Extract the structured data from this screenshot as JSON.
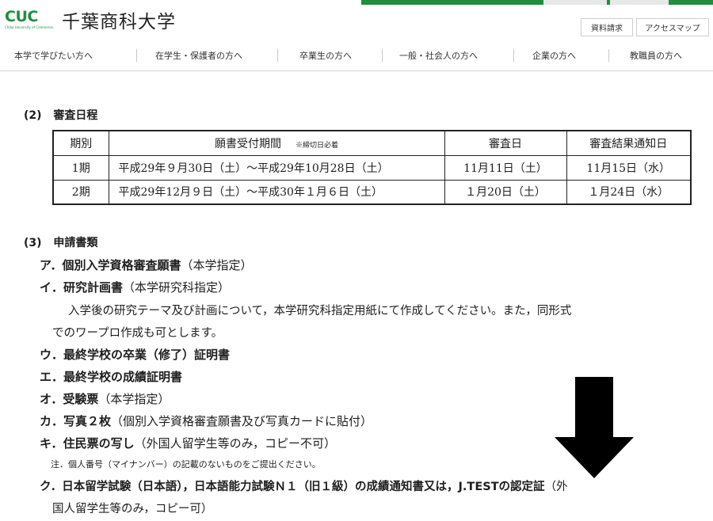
{
  "header": {
    "logo_mark": "CUC",
    "logo_sub": "Chiba University of Commerce",
    "university_name": "千葉商科大学",
    "util_request": "資料請求",
    "util_access": "アクセスマップ"
  },
  "nav": [
    "本学で学びたい方へ",
    "在学生・保護者の方へ",
    "卒業生の方へ",
    "一般・社会人の方へ",
    "企業の方へ",
    "教職員の方へ"
  ],
  "section2": {
    "heading_num": "(2)",
    "heading": "審査日程",
    "table": {
      "headers": [
        "期別",
        "願書受付期間",
        "※締切日必着",
        "審査日",
        "審査結果通知日"
      ],
      "rows": [
        [
          "1期",
          "平成29年９月30日（土）～平成29年10月28日（土）",
          "11月11日（土）",
          "11月15日（水）"
        ],
        [
          "2期",
          "平成29年12月９日（土）～平成30年１月６日（土）",
          "１月20日（土）",
          "１月24日（水）"
        ]
      ]
    }
  },
  "section3": {
    "heading_num": "(3)",
    "heading": "申請書類",
    "items": [
      {
        "mark": "ア．",
        "title": "個別入学資格審査願書",
        "note": "（本学指定）"
      },
      {
        "mark": "イ．",
        "title": "研究計画書",
        "note": "（本学研究科指定）"
      },
      {
        "mark": "ウ．",
        "title": "最終学校の卒業（修了）証明書",
        "note": ""
      },
      {
        "mark": "エ．",
        "title": "最終学校の成績証明書",
        "note": ""
      },
      {
        "mark": "オ．",
        "title": "受験票",
        "note": "（本学指定）"
      },
      {
        "mark": "カ．",
        "title": "写真２枚",
        "note": "（個別入学資格審査願書及び写真カードに貼付）"
      },
      {
        "mark": "キ．",
        "title": "住民票の写し",
        "note": "（外国人留学生等のみ，コピー不可）"
      },
      {
        "mark": "ク．",
        "title": "日本留学試験（日本語），日本語能力試験Ｎ１（旧１級）の成績通知書又は，J.TESTの認定証",
        "note": "（外"
      }
    ],
    "item_i_desc_line1": "入学後の研究テーマ及び計画について，本学研究科指定用紙にて作成してください。また，同形式",
    "item_i_desc_line2": "でのワープロ作成も可とします。",
    "item_ki_note": "注．個人番号（マイナンバー）の記載のないものをご提出ください。",
    "item_ku_line2": "国人留学生等のみ，コピー可）"
  },
  "colors": {
    "brand_green": "#1f8f3e",
    "arrow": "#000000"
  },
  "annotation_icon": "down-arrow-icon"
}
